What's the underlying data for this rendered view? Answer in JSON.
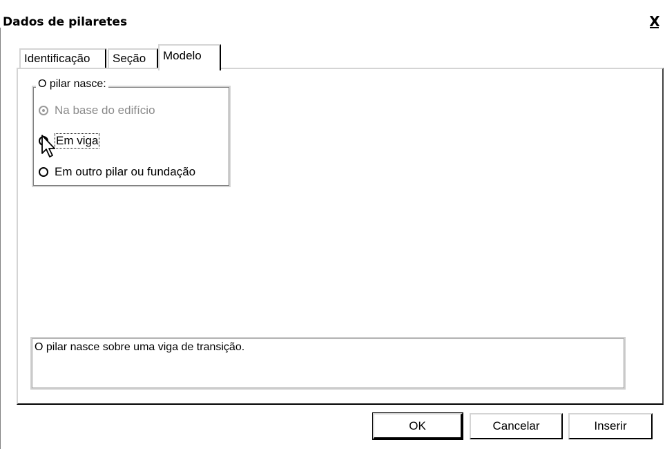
{
  "window": {
    "title": "Dados de pilaretes",
    "close_label": "X"
  },
  "tabs": [
    {
      "label": "Identificação",
      "active": false
    },
    {
      "label": "Seção",
      "active": false
    },
    {
      "label": "Modelo",
      "active": true
    }
  ],
  "origin_group": {
    "legend": "O pilar nasce:",
    "options": [
      {
        "label": "Na base do edifício",
        "selected": true,
        "enabled": false
      },
      {
        "label": "Em viga",
        "selected": true,
        "enabled": true,
        "focused": true
      },
      {
        "label": "Em outro pilar ou fundação",
        "selected": false,
        "enabled": true
      }
    ]
  },
  "description": "O pilar nasce sobre uma viga de transição.",
  "buttons": {
    "ok": "OK",
    "cancel": "Cancelar",
    "insert": "Inserir"
  },
  "icons": {
    "cursor": "mouse-pointer-icon",
    "close": "close-icon"
  }
}
